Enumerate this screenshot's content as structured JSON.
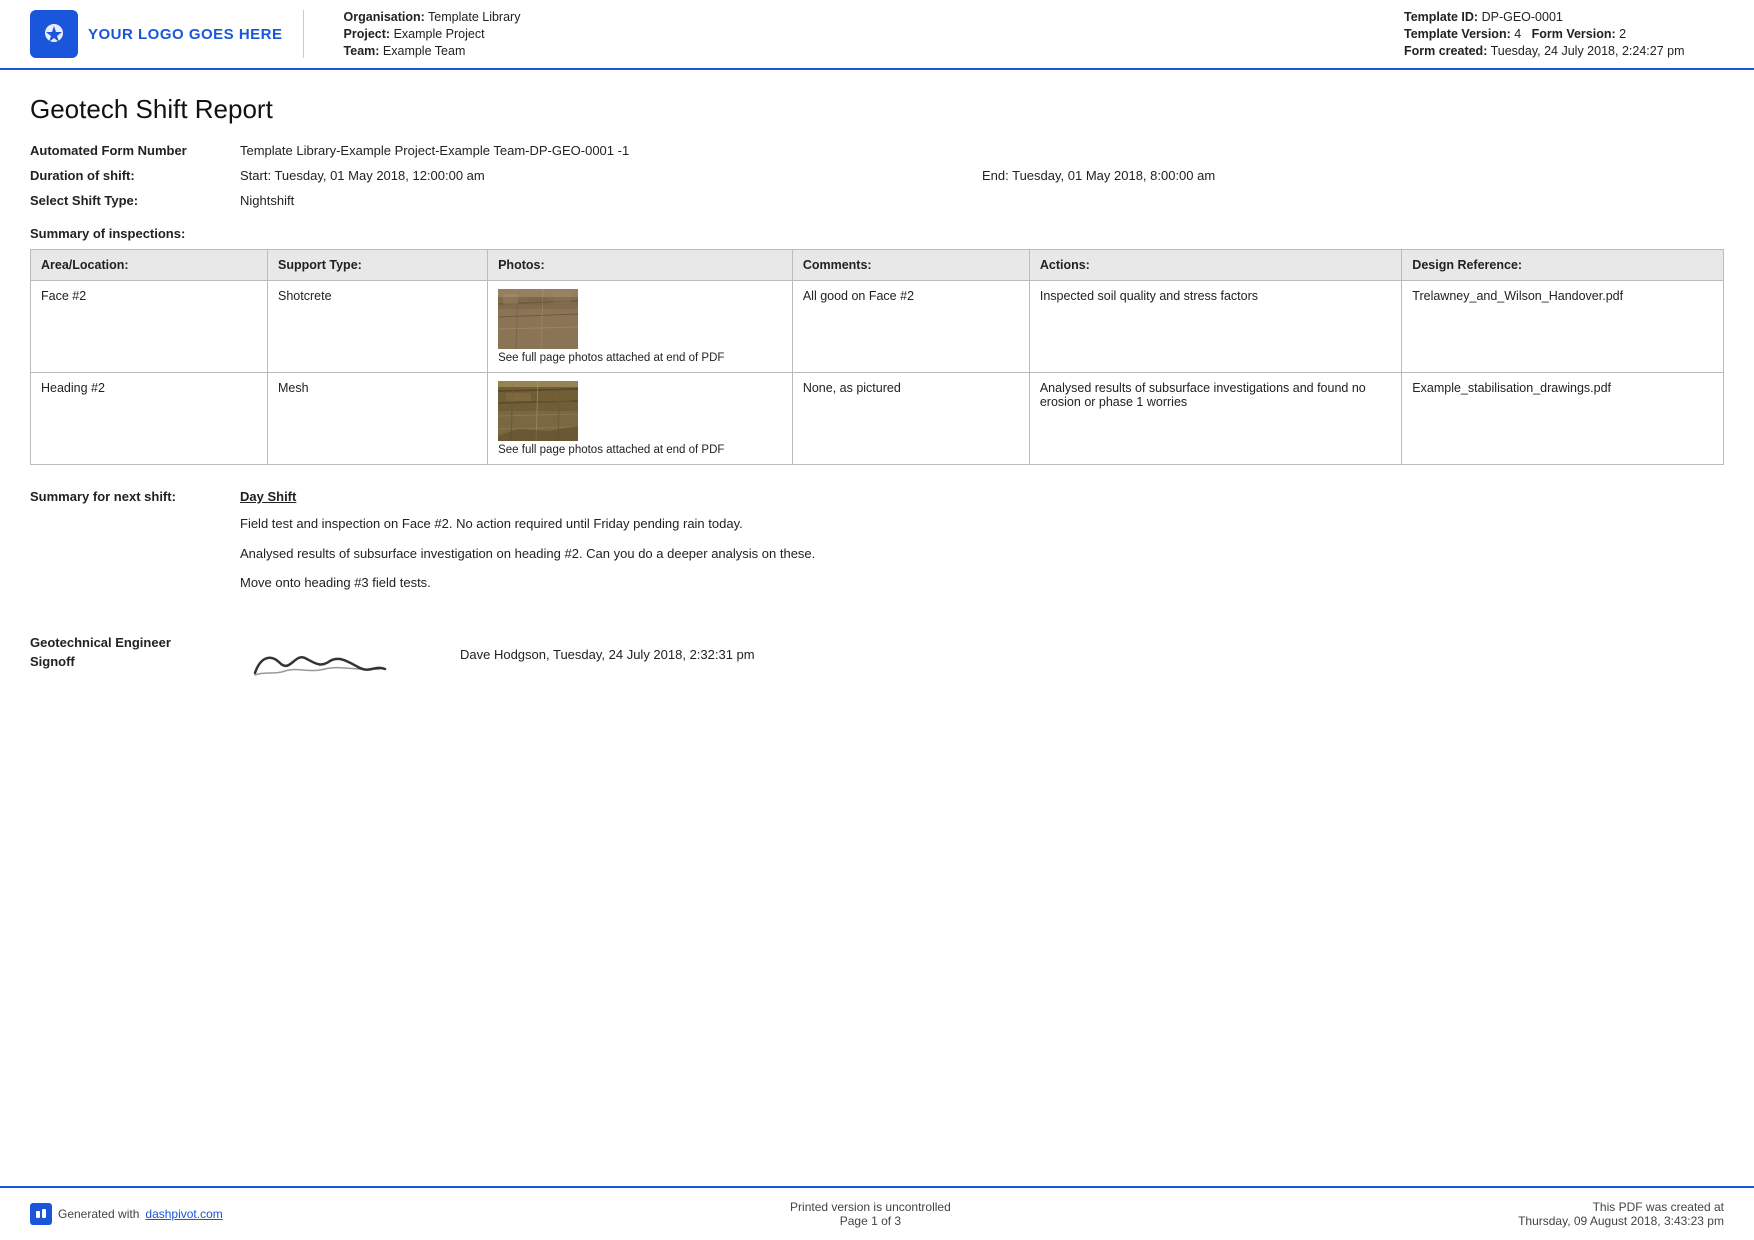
{
  "header": {
    "logo_text": "YOUR LOGO GOES HERE",
    "logo_icon": "⟳",
    "org_label": "Organisation:",
    "org_value": "Template Library",
    "project_label": "Project:",
    "project_value": "Example Project",
    "team_label": "Team:",
    "team_value": "Example Team",
    "template_id_label": "Template ID:",
    "template_id_value": "DP-GEO-0001",
    "template_version_label": "Template Version:",
    "template_version_value": "4",
    "form_version_label": "Form Version:",
    "form_version_value": "2",
    "form_created_label": "Form created:",
    "form_created_value": "Tuesday, 24 July 2018, 2:24:27 pm"
  },
  "report": {
    "title": "Geotech Shift Report",
    "form_number_label": "Automated Form Number",
    "form_number_value": "Template Library-Example Project-Example Team-DP-GEO-0001   -1",
    "duration_label": "Duration of shift:",
    "duration_start": "Start: Tuesday, 01 May 2018, 12:00:00 am",
    "duration_end": "End: Tuesday, 01 May 2018, 8:00:00 am",
    "shift_type_label": "Select Shift Type:",
    "shift_type_value": "Nightshift",
    "summary_label": "Summary of inspections:"
  },
  "table": {
    "headers": {
      "area": "Area/Location:",
      "support": "Support Type:",
      "photos": "Photos:",
      "comments": "Comments:",
      "actions": "Actions:",
      "design": "Design Reference:"
    },
    "rows": [
      {
        "area": "Face #2",
        "support": "Shotcrete",
        "photo_caption": "See full page photos attached at end of PDF",
        "comments": "All good on Face #2",
        "actions": "Inspected soil quality and stress factors",
        "design": "Trelawney_and_Wilson_Handover.pdf"
      },
      {
        "area": "Heading #2",
        "support": "Mesh",
        "photo_caption": "See full page photos attached at end of PDF",
        "comments": "None, as pictured",
        "actions": "Analysed results of subsurface investigations and found no erosion or phase 1 worries",
        "design": "Example_stabilisation_drawings.pdf"
      }
    ]
  },
  "next_shift": {
    "label": "Summary for next shift:",
    "heading": "Day Shift",
    "paras": [
      "Field test and inspection on Face #2. No action required until Friday pending rain today.",
      "Analysed results of subsurface investigation on heading #2. Can you do a deeper analysis on these.",
      "Move onto heading #3 field tests."
    ]
  },
  "signoff": {
    "label_line1": "Geotechnical Engineer",
    "label_line2": "Signoff",
    "signature_text": "Camun",
    "detail": "Dave Hodgson, Tuesday, 24 July 2018, 2:32:31 pm"
  },
  "footer": {
    "generated_text": "Generated with",
    "link_text": "dashpivot.com",
    "center_text": "Printed version is uncontrolled",
    "page_text": "Page 1 of 3",
    "right_line1": "This PDF was created at",
    "right_line2": "Thursday, 09 August 2018, 3:43:23 pm"
  }
}
